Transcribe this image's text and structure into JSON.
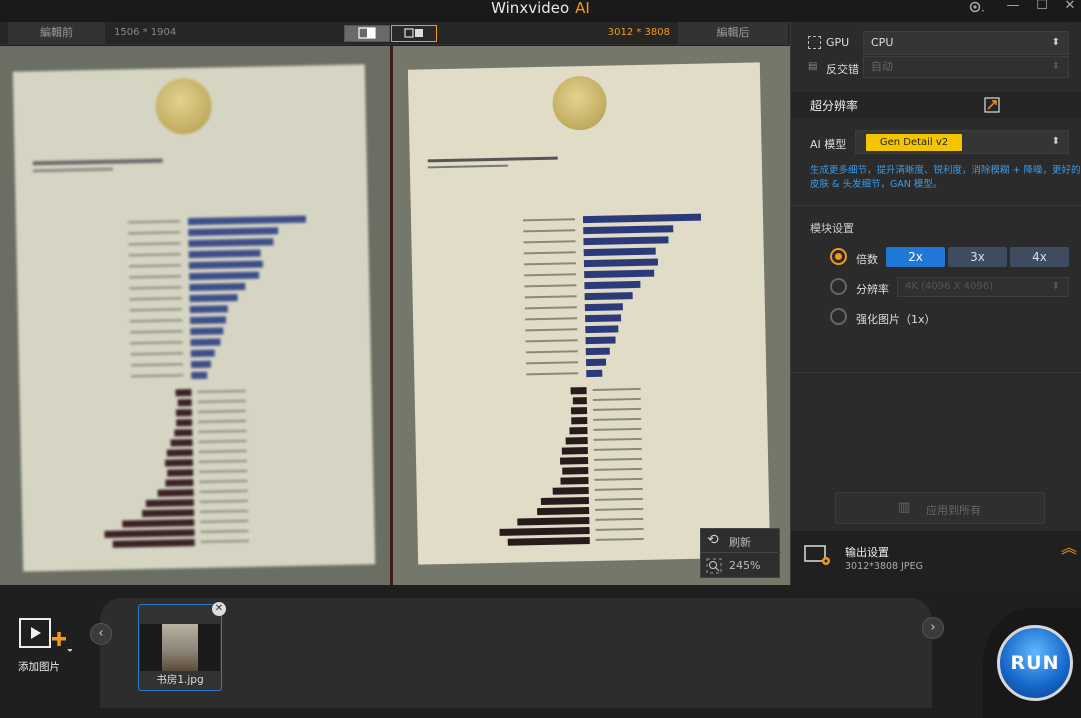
{
  "app": {
    "title": "Winxvideo",
    "title_ai": "AI"
  },
  "window": {
    "settings_icon": "gear-icon",
    "minimize": "—",
    "maximize": "☐",
    "close": "✕"
  },
  "toolbar": {
    "before_label": "編輯前",
    "after_label": "編輯后",
    "dim_before": "1506 * 1904",
    "dim_after": "3012 * 3808"
  },
  "preview": {
    "refresh_label": "刷新",
    "zoom_label": "245%"
  },
  "panel": {
    "gpu_label": "GPU",
    "gpu_value": "CPU",
    "deint_label": "反交错",
    "deint_value": "自动",
    "section_title": "超分辨率",
    "model_label": "AI 模型",
    "model_value": "Gen Detail v2",
    "model_desc": "生成更多细节，提升清晰度、锐利度，消除模糊 + 降噪，更好的皮肤 & 头发细节，GAN 模型。",
    "module_title": "模块设置",
    "scale_label": "倍数",
    "scale_options": [
      "2x",
      "3x",
      "4x"
    ],
    "resolution_label": "分辨率",
    "resolution_value": "4K (4096 X 4096)",
    "enhance_label": "强化图片（1x）",
    "apply_all": "应用到所有",
    "output_title": "输出设置",
    "output_detail": "3012*3808  JPEG"
  },
  "bottom": {
    "add_label": "添加图片",
    "thumb_name": "书房1.jpg",
    "run_label": "RUN"
  },
  "colors": {
    "accent": "#f39a1e",
    "model_badge": "#f5c400",
    "active_blue": "#1f78d6"
  }
}
